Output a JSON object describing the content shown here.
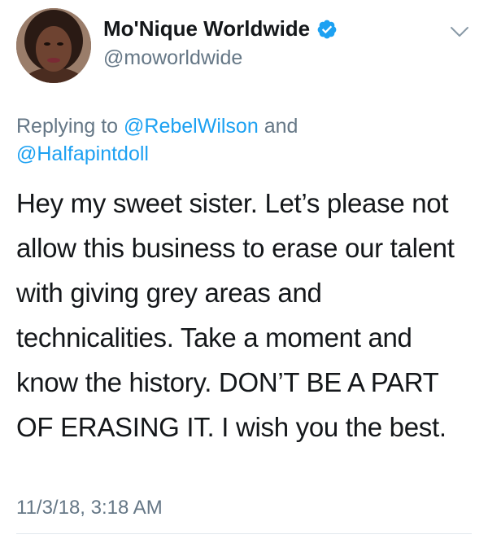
{
  "tweet": {
    "display_name": "Mo'Nique Worldwide",
    "handle": "@moworldwide",
    "verified": true,
    "reply_context": {
      "prefix": "Replying to ",
      "mention_1": "@RebelWilson",
      "joiner": " and ",
      "mention_2": "@Halfapintdoll"
    },
    "text": "Hey my sweet sister. Let’s please not allow this business to erase our talent with giving grey areas and technicalities. Take a moment and know the history. DON’T BE A PART OF ERASING IT. I wish you the best.",
    "timestamp": "11/3/18, 3:18 AM"
  },
  "icons": {
    "verified": "verified-badge-icon",
    "menu": "chevron-down-icon"
  },
  "colors": {
    "link": "#1da1f2",
    "secondary_text": "#657786",
    "primary_text": "#14171a",
    "verified_badge": "#1da1f2"
  }
}
